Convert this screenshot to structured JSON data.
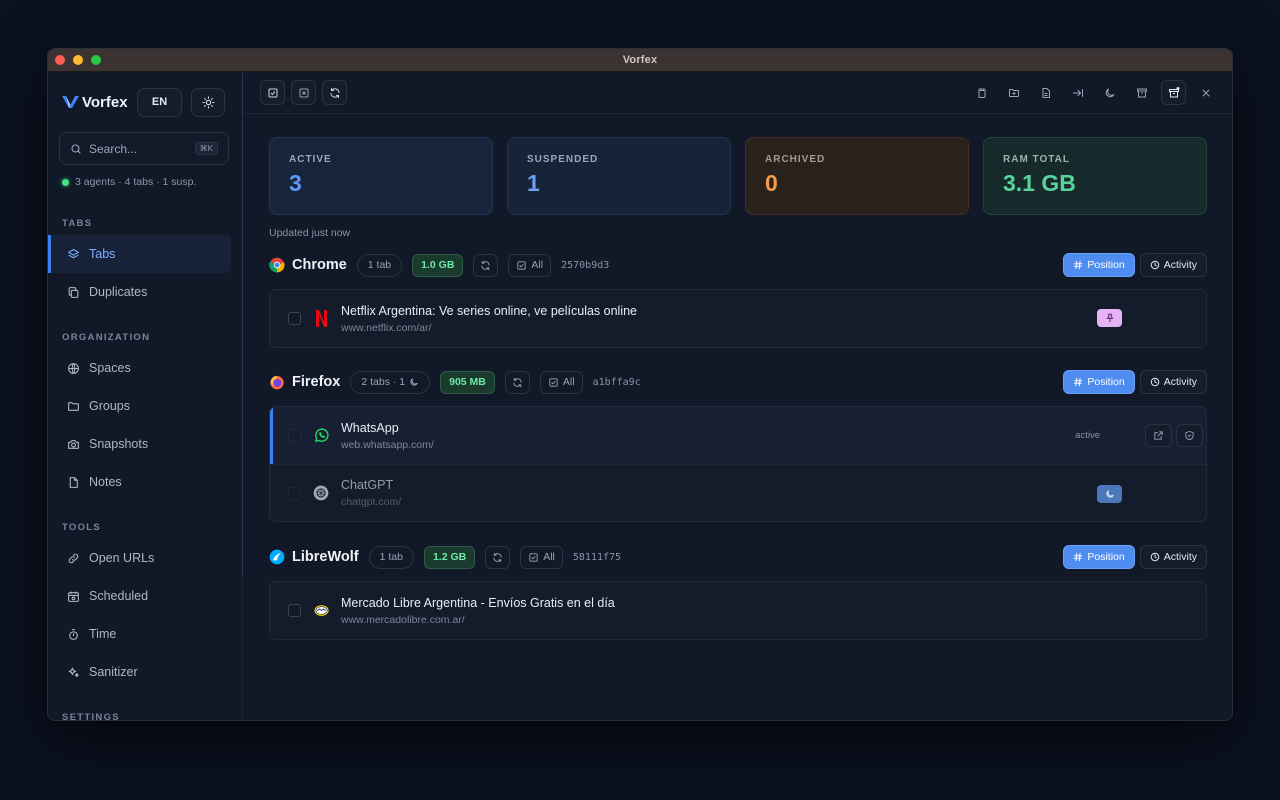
{
  "window": {
    "title": "Vorfex"
  },
  "sidebar": {
    "brand": "Vorfex",
    "lang": "EN",
    "search_placeholder": "Search...",
    "search_shortcut": "⌘K",
    "status": "3 agents · 4 tabs · 1 susp.",
    "sections": {
      "tabs": "TABS",
      "organization": "ORGANIZATION",
      "tools": "TOOLS",
      "settings": "SETTINGS"
    },
    "items": {
      "tabs": "Tabs",
      "duplicates": "Duplicates",
      "spaces": "Spaces",
      "groups": "Groups",
      "snapshots": "Snapshots",
      "notes": "Notes",
      "open_urls": "Open URLs",
      "scheduled": "Scheduled",
      "time": "Time",
      "sanitizer": "Sanitizer"
    },
    "accent": "#3b82f6"
  },
  "stats": {
    "active": {
      "label": "ACTIVE",
      "value": "3"
    },
    "suspended": {
      "label": "SUSPENDED",
      "value": "1"
    },
    "archived": {
      "label": "ARCHIVED",
      "value": "0"
    },
    "ram": {
      "label": "RAM TOTAL",
      "value": "3.1 GB"
    }
  },
  "updated": "Updated just now",
  "browsers": {
    "chrome": {
      "name": "Chrome",
      "tabs_chip": "1 tab",
      "mem": "1.0 GB",
      "all": "All",
      "hash": "2570b9d3",
      "position": "Position",
      "activity": "Activity",
      "rows": [
        {
          "title": "Netflix Argentina: Ve series online, ve películas online",
          "url": "www.netflix.com/ar/"
        }
      ]
    },
    "firefox": {
      "name": "Firefox",
      "tabs_chip": "2 tabs · 1",
      "mem": "905 MB",
      "all": "All",
      "hash": "a1bffa9c",
      "position": "Position",
      "activity": "Activity",
      "rows": [
        {
          "title": "WhatsApp",
          "url": "web.whatsapp.com/",
          "status": "active"
        },
        {
          "title": "ChatGPT",
          "url": "chatgpt.com/"
        }
      ]
    },
    "librewolf": {
      "name": "LibreWolf",
      "tabs_chip": "1 tab",
      "mem": "1.2 GB",
      "all": "All",
      "hash": "58111f75",
      "position": "Position",
      "activity": "Activity",
      "rows": [
        {
          "title": "Mercado Libre Argentina - Envíos Gratis en el día",
          "url": "www.mercadolibre.com.ar/"
        }
      ]
    }
  }
}
